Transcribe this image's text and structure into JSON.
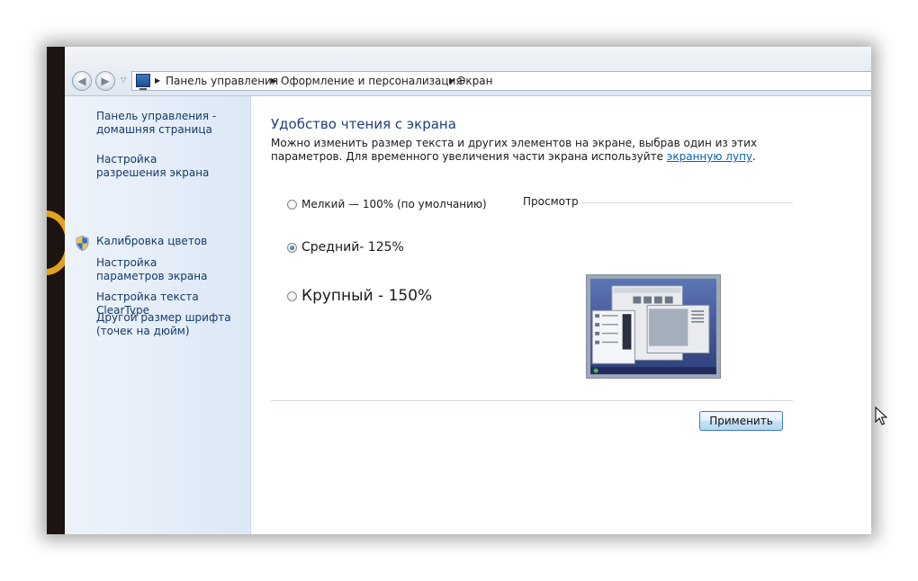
{
  "breadcrumb": {
    "items": [
      "Панель управления",
      "Оформление и персонализация",
      "Экран"
    ]
  },
  "sidebar": {
    "items": [
      {
        "label": "Панель управления - домашняя страница"
      },
      {
        "label": "Настройка разрешения экрана"
      },
      {
        "label": "Калибровка цветов",
        "icon": "uac-shield-icon"
      },
      {
        "label": "Настройка параметров экрана"
      },
      {
        "label": "Настройка текста ClearType"
      },
      {
        "label": "Другой размер шрифта (точек на дюйм)"
      }
    ]
  },
  "main": {
    "title": "Удобство чтения с экрана",
    "description": "Можно изменить размер текста и других элементов на экране, выбрав один из этих параметров. Для временного увеличения части экрана используйте ",
    "link_text": "экранную лупу",
    "description_end": ".",
    "options": [
      {
        "label": "Мелкий — 100% (по умолчанию)",
        "checked": false
      },
      {
        "label": "Средний- 125%",
        "checked": true
      },
      {
        "label": "Крупный - 150%",
        "checked": false
      }
    ],
    "preview_label": "Просмотр",
    "apply_label": "Применить"
  },
  "colors": {
    "link": "#0a5fb8",
    "heading": "#1e3e7a",
    "sidebar_link": "#123a6b",
    "accent_desktop": "#e3a21b"
  }
}
